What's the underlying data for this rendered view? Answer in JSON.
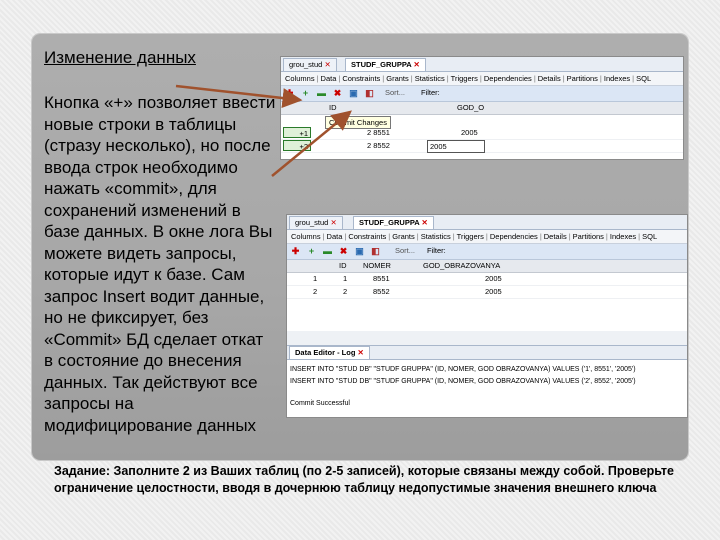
{
  "slide": {
    "title": "Изменение данных",
    "body": "Кнопка «+» позволяет ввести новые строки в таблицы (стразу несколько), но после ввода строк необходимо нажать «commit», для сохранений изменений в базе данных. В окне лога Вы можете видеть запросы, которые идут к базе. Сам запрос Insert водит данные, но не фиксирует, без «Commit» БД сделает откат в состояние до внесения данных. Так действуют все запросы на модифицирование данных",
    "task": "Задание: Заполните 2 из Ваших таблиц (по 2-5 записей), которые связаны между собой. Проверьте ограничение целостности, вводя в дочернюю таблицу недопустимые значения внешнего ключа"
  },
  "shot1": {
    "tab1": "grou_stud",
    "tab2": "STUDF_GRUPPA",
    "subtabs": [
      "Columns",
      "Data",
      "Constraints",
      "Grants",
      "Statistics",
      "Triggers",
      "Dependencies",
      "Details",
      "Partitions",
      "Indexes",
      "SQL"
    ],
    "sort_label": "Sort...",
    "filter_label": "Filter:",
    "tooltip": "Commit Changes",
    "col_id": "ID",
    "col_god": "GOD_O",
    "rows": [
      {
        "mark": "+1",
        "nomer": "2 8551",
        "god": "2005"
      },
      {
        "mark": "+2",
        "nomer": "2 8552",
        "god": "2005"
      }
    ]
  },
  "shot2": {
    "tab1": "grou_stud",
    "tab2": "STUDF_GRUPPA",
    "subtabs": [
      "Columns",
      "Data",
      "Constraints",
      "Grants",
      "Statistics",
      "Triggers",
      "Dependencies",
      "Details",
      "Partitions",
      "Indexes",
      "SQL"
    ],
    "sort_label": "Sort...",
    "filter_label": "Filter:",
    "columns": [
      "ID",
      "NOMER",
      "GOD_OBRAZOVANYA"
    ],
    "rows": [
      {
        "n": "1",
        "id": "1",
        "nomer": "8551",
        "god": "2005"
      },
      {
        "n": "2",
        "id": "2",
        "nomer": "8552",
        "god": "2005"
      }
    ],
    "log_tab": "Data Editor - Log",
    "log_lines": [
      "INSERT INTO \"STUD DB\" \"STUDF GRUPPA\" (ID, NOMER, GOD OBRAZOVANYA) VALUES ('1', 8551', '2005')",
      "INSERT INTO \"STUD DB\" \"STUDF GRUPPA\" (ID, NOMER, GOD OBRAZOVANYA) VALUES ('2', 8552', '2005')",
      "Commit Successful"
    ]
  },
  "colors": {
    "arrow": "#a0522d",
    "row_highlight": "#2a7a2a"
  }
}
